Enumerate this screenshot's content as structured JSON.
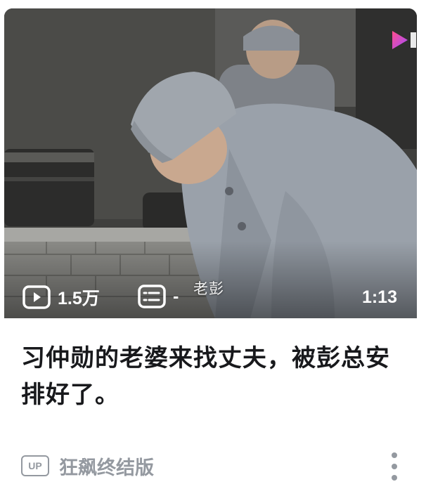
{
  "video": {
    "subtitle": "老彭",
    "view_count": "1.5万",
    "danmaku_count": "-",
    "duration": "1:13",
    "brand_logo": "bilibili-tv-logo"
  },
  "card": {
    "title": "习仲勋的老婆来找丈夫，被彭总安排好了。",
    "up_badge": "UP",
    "author": "狂飙终结版"
  },
  "icons": {
    "views": "play-icon",
    "danmaku": "danmaku-icon",
    "more": "more-vertical-icon"
  },
  "colors": {
    "title": "#18191c",
    "meta": "#9499a0",
    "overlay_text": "#ffffff"
  }
}
